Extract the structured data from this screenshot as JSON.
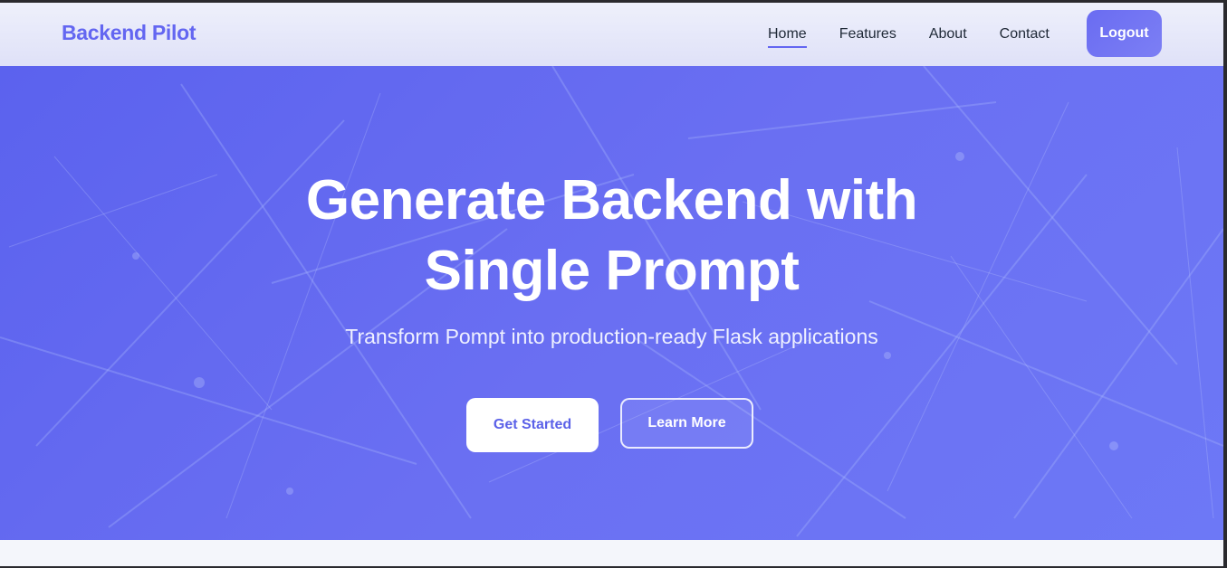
{
  "nav": {
    "brand": "Backend Pilot",
    "links": [
      {
        "label": "Home",
        "active": true
      },
      {
        "label": "Features",
        "active": false
      },
      {
        "label": "About",
        "active": false
      },
      {
        "label": "Contact",
        "active": false
      }
    ],
    "logout_label": "Logout"
  },
  "hero": {
    "title_line1": "Generate Backend with",
    "title_line2": "Single Prompt",
    "subtitle": "Transform Pompt into production-ready Flask applications",
    "primary_button": "Get Started",
    "secondary_button": "Learn More"
  },
  "colors": {
    "accent": "#6366f1",
    "hero_bg": "#6369f0",
    "text_dark": "#1f2937"
  }
}
